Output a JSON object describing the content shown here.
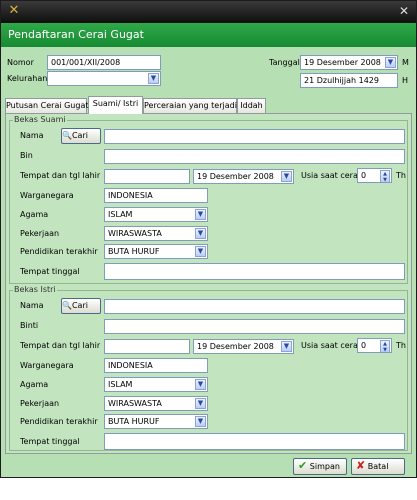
{
  "window": {
    "title": "Pendaftaran Cerai Gugat"
  },
  "top": {
    "nomor_label": "Nomor",
    "nomor_value": "001/001/XII/2008",
    "kelurahan_label": "Kelurahan",
    "kelurahan_value": "",
    "tanggal_label": "Tanggal",
    "tanggal_value": "19 Desember 2008",
    "tanggal_suffix": "M",
    "hijri_value": "21 Dzulhijjah 1429",
    "hijri_suffix": "H"
  },
  "tabs": [
    {
      "label": "Putusan Cerai Gugat"
    },
    {
      "label": "Suami/ Istri"
    },
    {
      "label": "Perceraian yang terjadi"
    },
    {
      "label": "Iddah"
    }
  ],
  "suami": {
    "group_title": "Bekas Suami",
    "nama_label": "Nama",
    "cari_label": "Cari",
    "nama_value": "",
    "bin_label": "Bin",
    "bin_value": "",
    "ttl_label": "Tempat dan tgl lahir",
    "tempat_value": "",
    "tgl_value": "19 Desember 2008",
    "usia_label": "Usia saat cerai",
    "usia_value": "0",
    "usia_unit": "Th",
    "warga_label": "Warganegara",
    "warga_value": "INDONESIA",
    "agama_label": "Agama",
    "agama_value": "ISLAM",
    "kerja_label": "Pekerjaan",
    "kerja_value": "WIRASWASTA",
    "didik_label": "Pendidikan terakhir",
    "didik_value": "BUTA HURUF",
    "tinggal_label": "Tempat tinggal",
    "tinggal_value": ""
  },
  "istri": {
    "group_title": "Bekas Istri",
    "nama_label": "Nama",
    "cari_label": "Cari",
    "nama_value": "",
    "bin_label": "Binti",
    "bin_value": "",
    "ttl_label": "Tempat dan tgl lahir",
    "tempat_value": "",
    "tgl_value": "19 Desember 2008",
    "usia_label": "Usia saat cerai",
    "usia_value": "0",
    "usia_unit": "Th",
    "warga_label": "Warganegara",
    "warga_value": "INDONESIA",
    "agama_label": "Agama",
    "agama_value": "ISLAM",
    "kerja_label": "Pekerjaan",
    "kerja_value": "WIRASWASTA",
    "didik_label": "Pendidikan terakhir",
    "didik_value": "BUTA HURUF",
    "tinggal_label": "Tempat tinggal",
    "tinggal_value": ""
  },
  "buttons": {
    "save_label": "Simpan",
    "cancel_label": "Batal"
  },
  "colors": {
    "header": "#1f9a3c",
    "background": "#b6dfb3",
    "save_icon": "#2e9b2e",
    "cancel_icon": "#cc2222"
  },
  "icons": [
    "app-icon",
    "close-icon",
    "search-icon",
    "check-icon",
    "x-icon",
    "chevron-down-icon",
    "spin-icon"
  ]
}
